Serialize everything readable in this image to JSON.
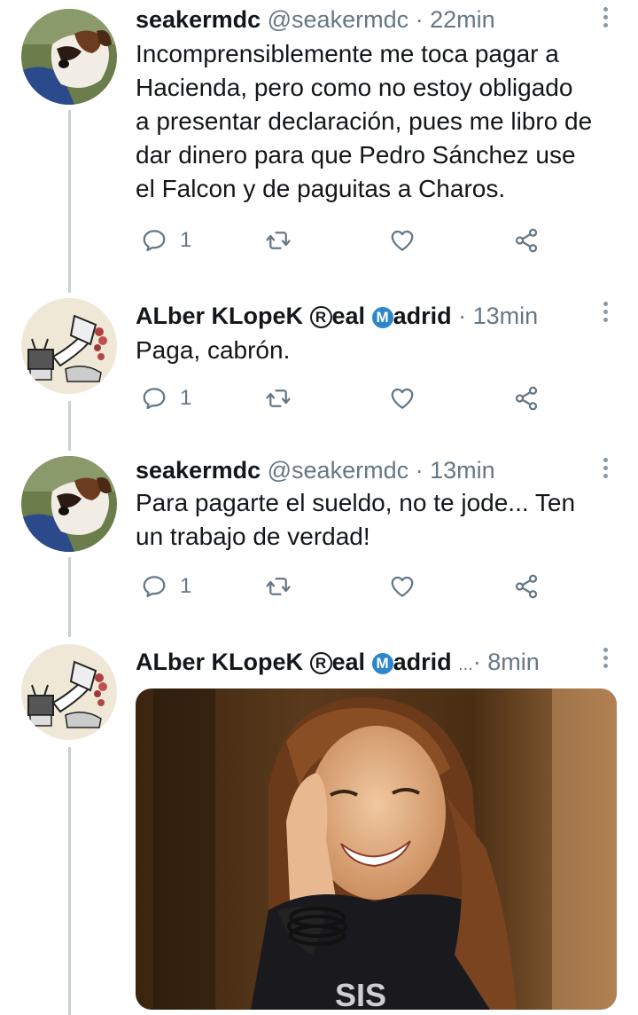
{
  "tweets": [
    {
      "name": "seakermdc",
      "handle": "@seakermdc",
      "separator": "·",
      "time": "22min",
      "text_lines": [
        "Incomprensiblemente me toca pagar a",
        "Hacienda, pero como no estoy obligado",
        "a presentar declaración, pues me libro de",
        "dar dinero para que Pedro Sánchez use",
        "el Falcon y de paguitas a Charos."
      ],
      "reply_count": "1"
    },
    {
      "name_parts": [
        "ALber KLopeK ",
        "R",
        "eal ",
        "M",
        "adrid"
      ],
      "separator": "·",
      "time": "13min",
      "text_lines": [
        "Paga, cabrón."
      ],
      "reply_count": "1"
    },
    {
      "name": "seakermdc",
      "handle": "@seakermdc",
      "separator": "·",
      "time": "13min",
      "text_lines": [
        "Para pagarte el sueldo, no te jode... Ten",
        "un trabajo de verdad!"
      ],
      "reply_count": "1"
    },
    {
      "name_parts": [
        "ALber KLopeK ",
        "R",
        "eal ",
        "M",
        "adrid"
      ],
      "ellipsis": "...",
      "separator": "·",
      "time": "8min",
      "media_text": "SIS"
    }
  ],
  "icons": {
    "reply": "reply-icon",
    "retweet": "retweet-icon",
    "like": "heart-icon",
    "share": "share-icon",
    "more": "more-vertical-icon"
  },
  "colors": {
    "text": "#14171a",
    "secondary": "#657786",
    "icon": "#657786",
    "thread_line": "#c8cfd6",
    "badge_m": "#2d86c9"
  }
}
